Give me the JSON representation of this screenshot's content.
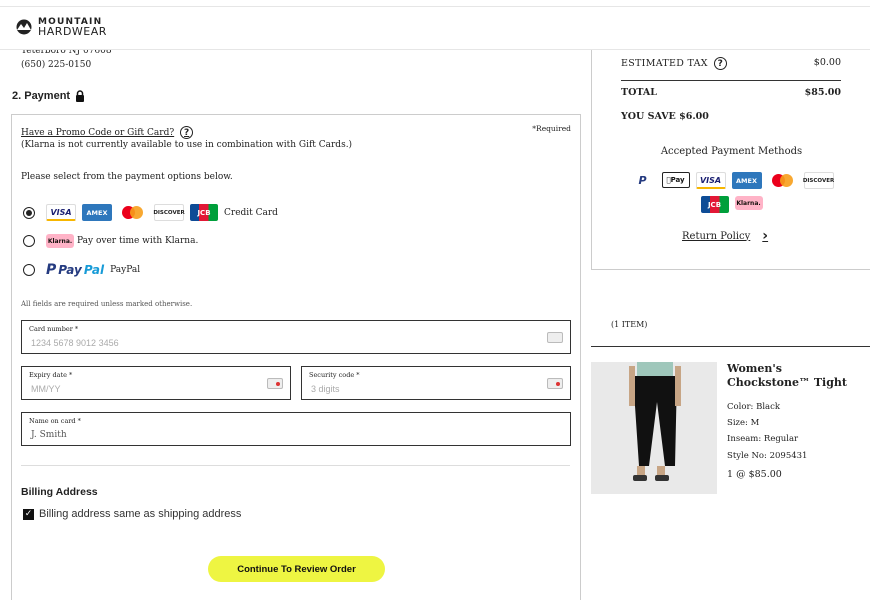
{
  "brand": {
    "line1": "MOUNTAIN",
    "line2": "HARDWEAR"
  },
  "shipping_address": {
    "line1": "Teterboro NJ 07608",
    "phone": "(650) 225-0150"
  },
  "payment": {
    "title": "2. Payment",
    "promo_link": "Have a Promo Code or Gift Card?",
    "required_note": "*Required",
    "klarna_note": "(Klarna is not currently available to use in combination with Gift Cards.)",
    "select_prompt": "Please select from the payment options below.",
    "options": [
      {
        "label": "Credit Card",
        "selected": true
      },
      {
        "label": "Pay over time with Klarna.",
        "selected": false
      },
      {
        "label": "PayPal",
        "selected": false
      }
    ],
    "card_logos": {
      "visa": "VISA",
      "amex": "AMEX",
      "discover": "DISCOVER",
      "jcb": "JCB",
      "klarna": "Klarna.",
      "paypal_a": "Pay",
      "paypal_b": "Pal"
    },
    "fields_note": "All fields are required unless marked otherwise.",
    "card_number": {
      "label": "Card number *",
      "placeholder": "1234 5678 9012 3456"
    },
    "expiry": {
      "label": "Expiry date *",
      "placeholder": "MM/YY"
    },
    "security": {
      "label": "Security code *",
      "placeholder": "3 digits"
    },
    "name_on_card": {
      "label": "Name on card *",
      "placeholder": "J. Smith"
    }
  },
  "billing": {
    "title": "Billing Address",
    "same_as_shipping_label": "Billing address same as shipping address",
    "same_as_shipping_checked": true
  },
  "continue_button": "Continue To Review Order",
  "summary": {
    "tax_label": "ESTIMATED TAX",
    "tax_value": "$0.00",
    "total_label": "TOTAL",
    "total_value": "$85.00",
    "you_save": "YOU SAVE $6.00",
    "accepted_title": "Accepted Payment Methods",
    "methods": {
      "paypal": "P",
      "applepay": "Pay",
      "visa": "VISA",
      "amex": "AMEX",
      "discover": "DISCOVER",
      "jcb": "JCB",
      "klarna": "Klarna."
    },
    "return_policy": "Return Policy"
  },
  "cart": {
    "items_count": "(1 ITEM)",
    "product": {
      "name": "Women's Chockstone™ Tight",
      "color": "Color: Black",
      "size": "Size: M",
      "inseam": "Inseam: Regular",
      "style": "Style No: 2095431",
      "qty_price": "1 @ $85.00"
    }
  },
  "colors": {
    "cta": "#eef542",
    "border": "#cccccc"
  }
}
